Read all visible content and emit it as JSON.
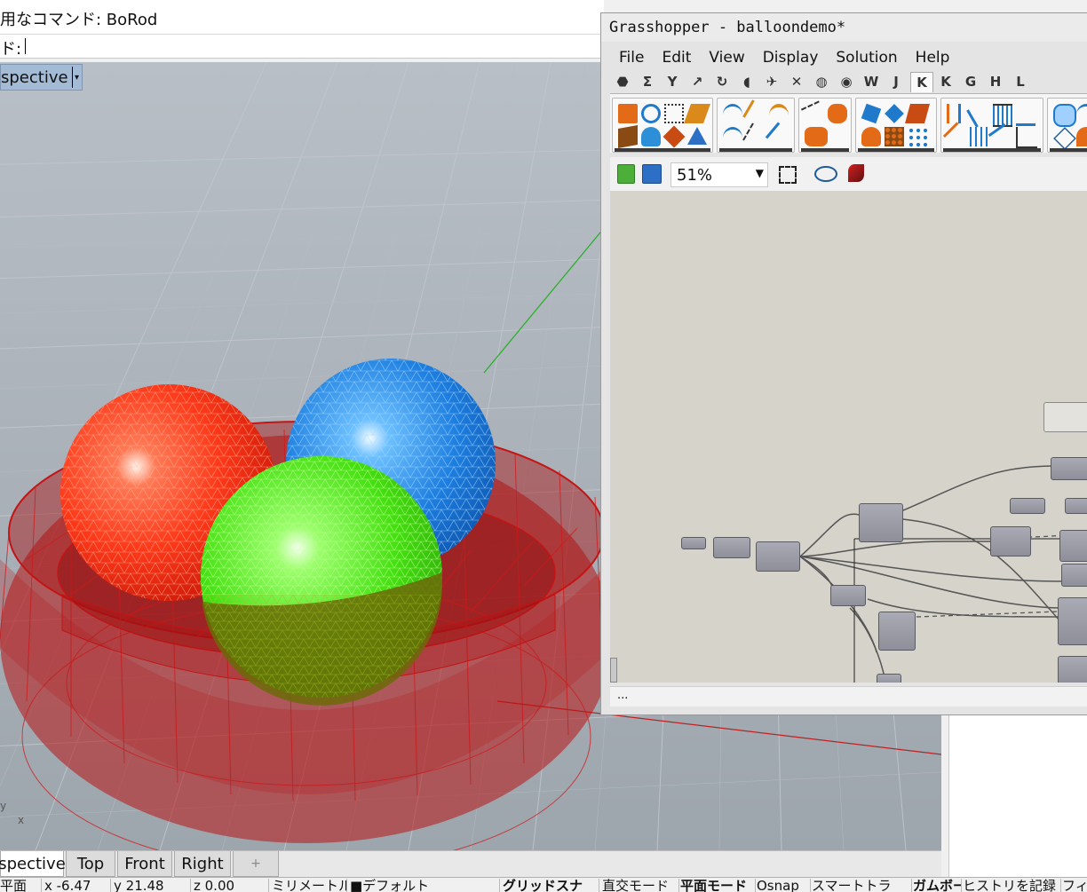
{
  "rhino": {
    "command_history": "用なコマンド: BoRod",
    "command_prompt": "ド:",
    "viewport_title": "spective",
    "viewport_menu_arrow": "▾",
    "axis_labels": {
      "y": "y",
      "x": "x"
    },
    "view_tabs": [
      "spective",
      "Top",
      "Front",
      "Right"
    ],
    "add_tab_icon": "+",
    "active_tab": 0
  },
  "status_bar": {
    "cells": [
      "平面",
      "x -6.47",
      "y 21.48",
      "z 0.00",
      "ミリメートル",
      "■デフォルト",
      "グリッドスナ",
      "直交モード",
      "平面モード",
      "Osnap",
      "スマートトラ",
      "ガムボール",
      "ヒストリを記録",
      "フィ"
    ]
  },
  "grasshopper": {
    "title": "Grasshopper - balloondemo*",
    "menu": [
      "File",
      "Edit",
      "View",
      "Display",
      "Solution",
      "Help"
    ],
    "tabs": [
      "⬣",
      "Σ",
      "Y",
      "↗",
      "↻",
      "◖",
      "✈",
      "✕",
      "◍",
      "◉",
      "W",
      "J",
      "K",
      "K",
      "G",
      "H",
      "L"
    ],
    "active_tab_index": 12,
    "zoom": "51%",
    "zoom_arrow": "▼",
    "statusbar_text": "..."
  },
  "colors": {
    "viewport_bg": "#a9b0b8",
    "grid": "#c3c8ce",
    "bowl": "#b81414",
    "sphere_red": "#ff3a1a",
    "sphere_blue": "#1e7fe0",
    "sphere_green": "#44e010",
    "gh_canvas": "#d6d3cb"
  }
}
